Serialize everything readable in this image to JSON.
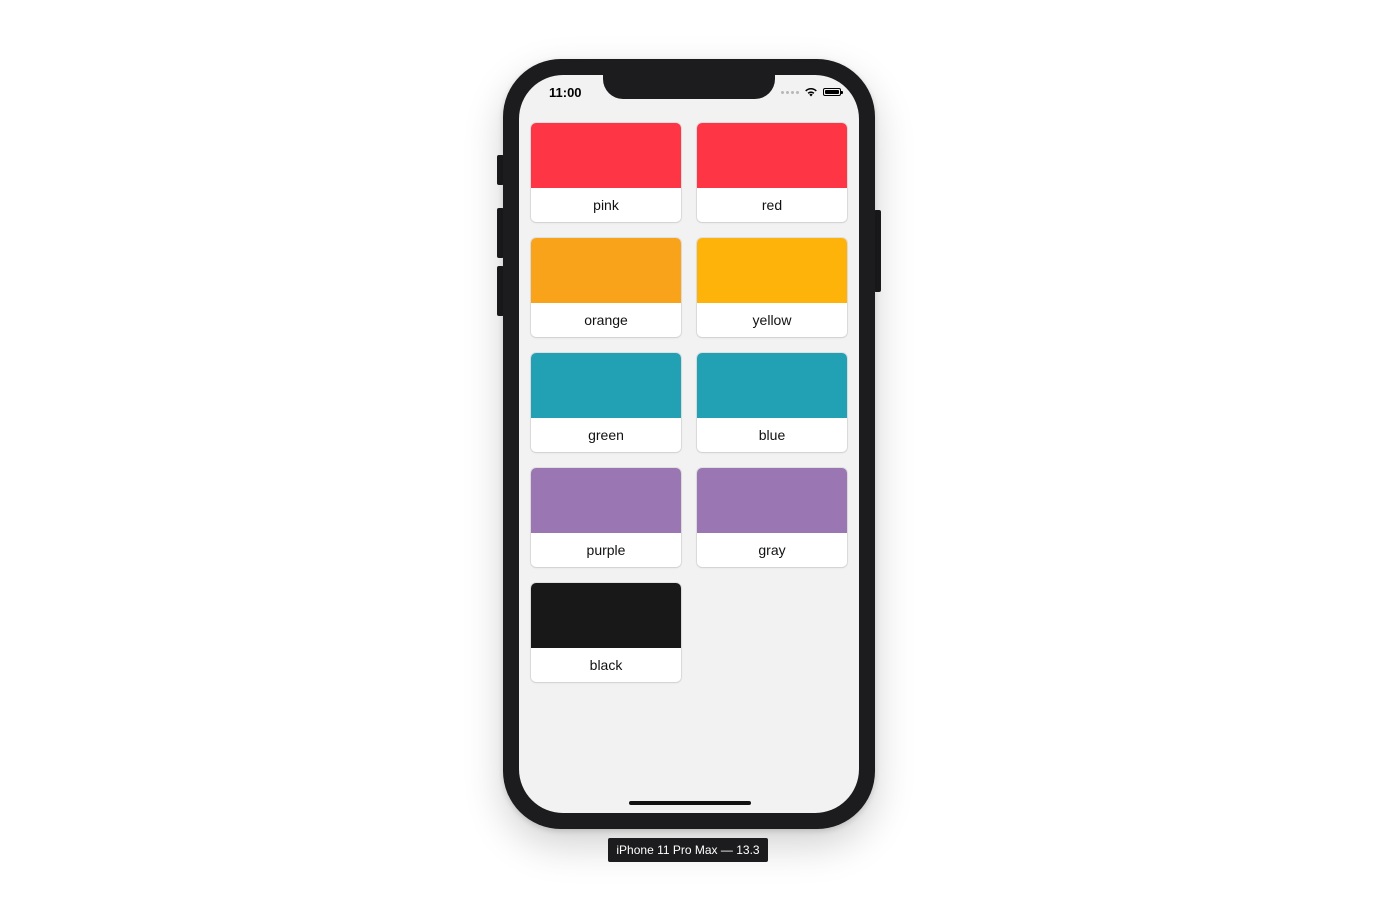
{
  "status_bar": {
    "time": "11:00"
  },
  "colors": [
    {
      "label": "pink",
      "swatch": "#fd3544"
    },
    {
      "label": "red",
      "swatch": "#fd3544"
    },
    {
      "label": "orange",
      "swatch": "#f8a319"
    },
    {
      "label": "yellow",
      "swatch": "#feb30a"
    },
    {
      "label": "green",
      "swatch": "#22a1b4"
    },
    {
      "label": "blue",
      "swatch": "#22a1b4"
    },
    {
      "label": "purple",
      "swatch": "#9a76b3"
    },
    {
      "label": "gray",
      "swatch": "#9a76b3"
    },
    {
      "label": "black",
      "swatch": "#181818"
    }
  ],
  "device_label": "iPhone 11 Pro Max — 13.3"
}
